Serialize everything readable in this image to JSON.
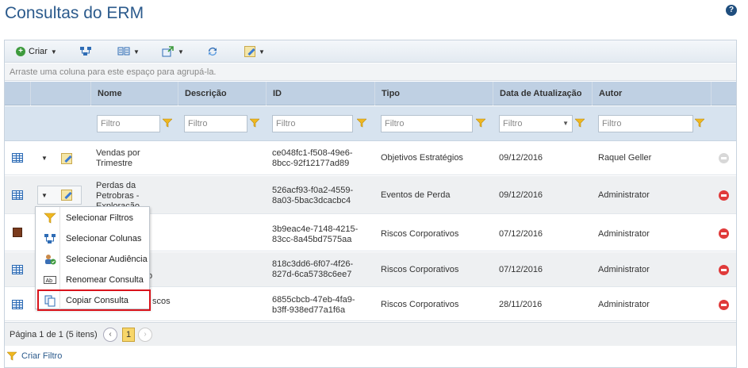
{
  "page": {
    "title": "Consultas do ERM"
  },
  "toolbar": {
    "create_label": "Criar"
  },
  "grouping_hint": "Arraste uma coluna para este espaço para agrupá-la.",
  "columns": [
    "Nome",
    "Descrição",
    "ID",
    "Tipo",
    "Data de Atualização",
    "Autor"
  ],
  "filter_placeholder": "Filtro",
  "rows": [
    {
      "name": "Vendas por Trimestre",
      "name_l1": "Vendas por",
      "name_l2": "Trimestre",
      "id_l1": "ce048fc1-f508-49e6-",
      "id_l2": "8bcc-92f12177ad89",
      "type": "Objetivos Estratégios",
      "date": "09/12/2016",
      "author": "Raquel Geller"
    },
    {
      "name_l1": "Perdas da",
      "name_l2": "Petrobras -",
      "name_l3": "Exploração",
      "id_l1": "526acf93-f0a2-4559-",
      "id_l2": "8a03-5bac3dcacbc4",
      "type": "Eventos de Perda",
      "date": "09/12/2016",
      "author": "Administrator"
    },
    {
      "id_l1": "3b9eac4e-7148-4215-",
      "id_l2": "83cc-8a45bd7575aa",
      "type": "Riscos Corporativos",
      "date": "07/12/2016",
      "author": "Administrator"
    },
    {
      "name_frag": "o",
      "id_l1": "818c3dd6-6f07-4f26-",
      "id_l2": "827d-6ca5738c6ee7",
      "type": "Riscos Corporativos",
      "date": "07/12/2016",
      "author": "Administrator"
    },
    {
      "name_frag": "scos",
      "id_l1": "6855cbcb-47eb-4fa9-",
      "id_l2": "b3ff-938ed77a1f6a",
      "type": "Riscos Corporativos",
      "date": "28/11/2016",
      "author": "Administrator"
    }
  ],
  "pager": {
    "text": "Página 1 de 1 (5 itens)",
    "current": "1"
  },
  "create_filter": "Criar Filtro",
  "menu": {
    "items": [
      {
        "label": "Selecionar Filtros",
        "icon": "funnel-icon"
      },
      {
        "label": "Selecionar Colunas",
        "icon": "columns-icon"
      },
      {
        "label": "Selecionar Audiência",
        "icon": "audience-icon"
      },
      {
        "label": "Renomear Consulta",
        "icon": "rename-icon"
      },
      {
        "label": "Copiar Consulta",
        "icon": "copy-icon"
      }
    ]
  },
  "colors": {
    "accent": "#2b5a8c",
    "header_bg": "#bfd0e3",
    "filter_bg": "#d7e3ef",
    "highlight": "#d9131b",
    "delete": "#e03b3b"
  }
}
